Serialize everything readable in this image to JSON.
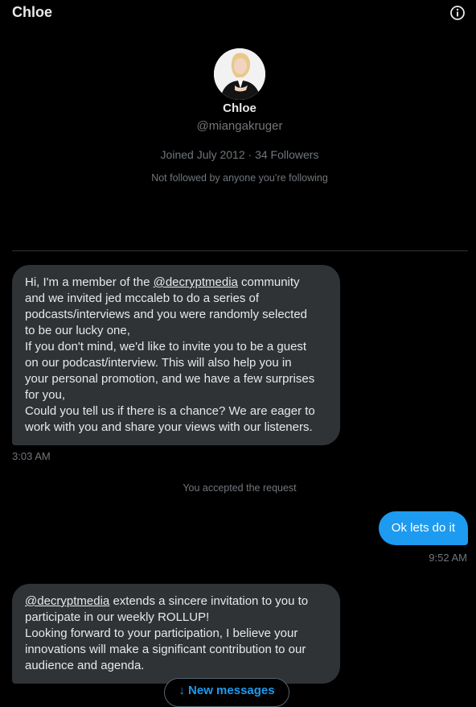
{
  "header": {
    "title": "Chloe",
    "info_icon": "info-circle-icon"
  },
  "profile": {
    "name": "Chloe",
    "handle": "@miangakruger",
    "joined": "Joined July 2012 · 34 Followers",
    "follow_note": "Not followed by anyone you’re following"
  },
  "messages": [
    {
      "direction": "incoming",
      "mention": "@decryptmedia",
      "text_before": "Hi, I'm a member of the ",
      "text_after": " community\nand we invited jed mccaleb to do a series of\npodcasts/interviews and you were randomly selected\nto be our lucky one,\nIf you don't mind, we'd like to invite you to be a guest\non our podcast/interview. This will also help you in\nyour personal promotion, and we have a few surprises\nfor you,\nCould you tell us if there is a chance? We are eager to\nwork with you and share your views with our listeners.",
      "time": "3:03 AM"
    },
    {
      "direction": "system",
      "text": "You accepted the request"
    },
    {
      "direction": "outgoing",
      "text": "Ok lets do it",
      "time": "9:52 AM"
    },
    {
      "direction": "incoming",
      "mention": "@decryptmedia",
      "text_before": "",
      "text_after": " extends a sincere invitation to you to\nparticipate in our weekly ROLLUP!\nLooking forward to your participation,   I believe your\ninnovations will make a significant contribution to our\naudience and agenda.",
      "time": ""
    }
  ],
  "new_messages_pill": {
    "label": "↓ New messages"
  },
  "colors": {
    "accent": "#1d9bf0",
    "bubble_in": "#2f3336",
    "background": "#000000"
  }
}
